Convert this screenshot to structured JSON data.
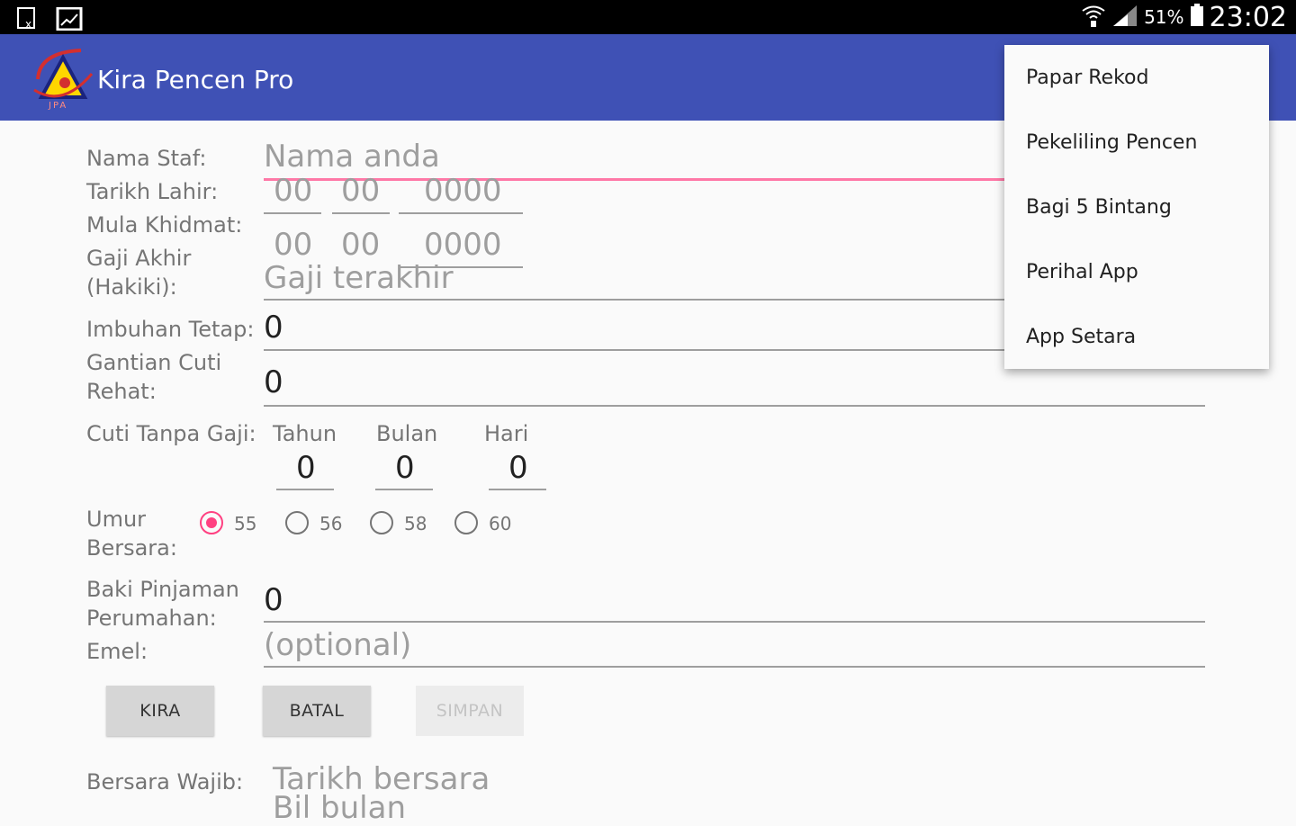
{
  "status_bar": {
    "battery": "51%",
    "time": "23:02"
  },
  "app_bar": {
    "title": "Kira Pencen Pro",
    "logo_text": "JPA"
  },
  "form": {
    "nama_staf": {
      "label": "Nama Staf:",
      "placeholder": "Nama anda"
    },
    "tarikh_lahir": {
      "label": "Tarikh Lahir:",
      "day": "00",
      "month": "00",
      "year": "0000"
    },
    "mula_khidmat": {
      "label": "Mula Khidmat:",
      "day": "00",
      "month": "00",
      "year": "0000"
    },
    "gaji_akhir": {
      "label_line1": "Gaji Akhir",
      "label_line2": "(Hakiki):",
      "placeholder": "Gaji terakhir"
    },
    "imbuhan_tetap": {
      "label": "Imbuhan Tetap:",
      "value": "0"
    },
    "gantian_cuti": {
      "label_line1": "Gantian Cuti",
      "label_line2": "Rehat:",
      "value": "0"
    },
    "cuti_tanpa_gaji": {
      "label": "Cuti Tanpa Gaji:",
      "tahun_label": "Tahun",
      "tahun": "0",
      "bulan_label": "Bulan",
      "bulan": "0",
      "hari_label": "Hari",
      "hari": "0"
    },
    "umur_bersara": {
      "label_line1": "Umur",
      "label_line2": "Bersara:",
      "options": [
        "55",
        "56",
        "58",
        "60"
      ],
      "selected": "55"
    },
    "baki_pinjaman": {
      "label_line1": "Baki Pinjaman",
      "label_line2": "Perumahan:",
      "value": "0"
    },
    "emel": {
      "label": "Emel:",
      "placeholder": "(optional)"
    }
  },
  "buttons": {
    "kira": "KIRA",
    "batal": "BATAL",
    "simpan": "SIMPAN"
  },
  "result": {
    "bersara_wajib_label": "Bersara Wajib:",
    "tarikh_bersara": "Tarikh bersara",
    "bil_bulan": "Bil bulan"
  },
  "overflow_menu": {
    "items": [
      "Papar Rekod",
      "Pekeliling Pencen",
      "Bagi 5 Bintang",
      "Perihal App",
      "App Setara"
    ]
  },
  "colors": {
    "primary": "#3f51b5",
    "accent": "#ff4081",
    "status_bar": "#000000"
  }
}
